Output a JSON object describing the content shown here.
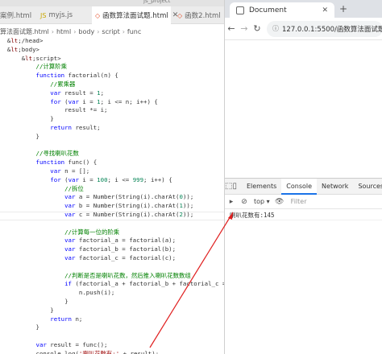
{
  "window": {
    "project": "js_project"
  },
  "editor_tabs": [
    {
      "label": "案例.html",
      "active": false
    },
    {
      "label": "myjs.js",
      "active": false
    },
    {
      "label": "函数算法面试题.html",
      "active": true
    },
    {
      "label": "函数2.html",
      "active": false
    }
  ],
  "breadcrumb": [
    "算法面试题.html",
    "html",
    "body",
    "script",
    "func"
  ],
  "code_lines": [
    "  </head>",
    "  <body>",
    "      <script>",
    "          //计算阶乘",
    "          function factorial(n) {",
    "              //累乘器",
    "              var result = 1;",
    "              for (var i = 1; i <= n; i++) {",
    "                  result *= i;",
    "              }",
    "              return result;",
    "          }",
    "",
    "          //寻找喇叭花数",
    "          function func() {",
    "              var n = [];",
    "              for (var i = 100; i <= 999; i++) {",
    "                  //拆位",
    "                  var a = Number(String(i).charAt(0));",
    "                  var b = Number(String(i).charAt(1));",
    "                  var c = Number(String(i).charAt(2));",
    "",
    "                  //计算每一位的阶乘",
    "                  var factorial_a = factorial(a);",
    "                  var factorial_b = factorial(b);",
    "                  var factorial_c = factorial(c);",
    "",
    "                  //判断是否是喇叭花数，然后推入喇叭花数数组",
    "                  if (factorial_a + factorial_b + factorial_c == i)",
    "                      n.push(i);",
    "                  }",
    "              }",
    "              return n;",
    "          }",
    "",
    "          var result = func();",
    "          console.log('喇叭花数有:' + result);"
  ],
  "browser": {
    "tab_title": "Document",
    "url": "127.0.0.1:5500/函数算法面试题.h",
    "back_icon": "arrow-left-icon",
    "forward_icon": "arrow-right-icon",
    "reload_icon": "reload-icon"
  },
  "devtools": {
    "tabs": [
      "Elements",
      "Console",
      "Network",
      "Sources"
    ],
    "active_tab": "Console",
    "context": "top",
    "filter_placeholder": "Filter",
    "console_output": "喇叭花数有:145"
  },
  "colors": {
    "keyword": "#0000ff",
    "comment": "#008000",
    "string": "#a31515",
    "number": "#098658",
    "arrow": "#e02020",
    "devtools_accent": "#1a73e8"
  }
}
